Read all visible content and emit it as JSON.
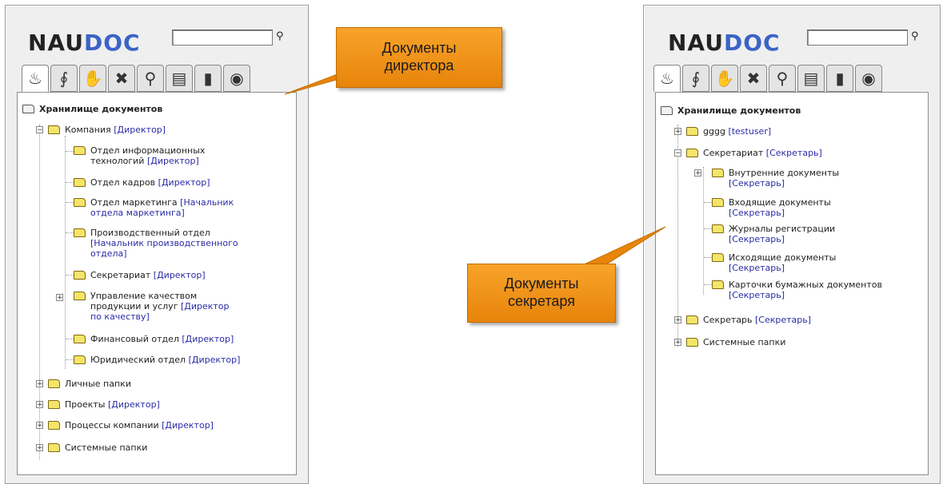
{
  "colors": {
    "callout": "#f39a1d",
    "role_link": "#2a2aa6",
    "folder": "#f4e56a",
    "logo_accent": "#3b63c7"
  },
  "brand": {
    "part1": "NAU",
    "part2": "DOC"
  },
  "toolbar_icons": [
    "tree-icon",
    "workflow-icon",
    "hand-icon",
    "tools-icon",
    "search-icon",
    "cabinet-icon",
    "book-icon",
    "camera-icon"
  ],
  "left": {
    "root": "Хранилище документов",
    "company": {
      "label": "Компания",
      "role": "[Директор]"
    },
    "depts": [
      {
        "l1": "Отдел информационных",
        "l2": "технологий",
        "role": "[Директор]"
      },
      {
        "l1": "Отдел кадров",
        "role": "[Директор]"
      },
      {
        "l1": "Отдел маркетинга",
        "role1": "[Начальник",
        "role2": "отдела маркетинга]"
      },
      {
        "l1": "Производственный отдел",
        "role1": "[Начальник производственного",
        "role2": "отдела]"
      },
      {
        "l1": "Секретариат",
        "role": "[Директор]"
      },
      {
        "l1": "Управление качеством",
        "l2": "продукции и услуг",
        "role1": "[Директор",
        "role2": "по качеству]"
      },
      {
        "l1": "Финансовый отдел",
        "role": "[Директор]"
      },
      {
        "l1": "Юридический отдел",
        "role": "[Директор]"
      }
    ],
    "bottom": [
      {
        "l": "Личные папки"
      },
      {
        "l": "Проекты",
        "role": "[Директор]"
      },
      {
        "l": "Процессы компании",
        "role": "[Директор]"
      },
      {
        "l": "Системные папки"
      }
    ]
  },
  "right": {
    "root": "Хранилище документов",
    "gggg": {
      "label": "gggg",
      "role": "[testuser]"
    },
    "secretariat": {
      "label": "Секретариат",
      "role": "[Секретарь]"
    },
    "children": [
      {
        "l": "Внутренние документы",
        "role": "[Секретарь]"
      },
      {
        "l": "Входящие документы",
        "role": "[Секретарь]"
      },
      {
        "l": "Журналы регистрации",
        "role": "[Секретарь]"
      },
      {
        "l": "Исходящие документы",
        "role": "[Секретарь]"
      },
      {
        "l": "Карточки бумажных документов",
        "role": "[Секретарь]"
      }
    ],
    "secretary": {
      "label": "Секретарь",
      "role": "[Секретарь]"
    },
    "system": "Системные папки"
  },
  "callouts": {
    "director": [
      "Документы",
      "директора"
    ],
    "secretary": [
      "Документы",
      "секретаря"
    ]
  }
}
